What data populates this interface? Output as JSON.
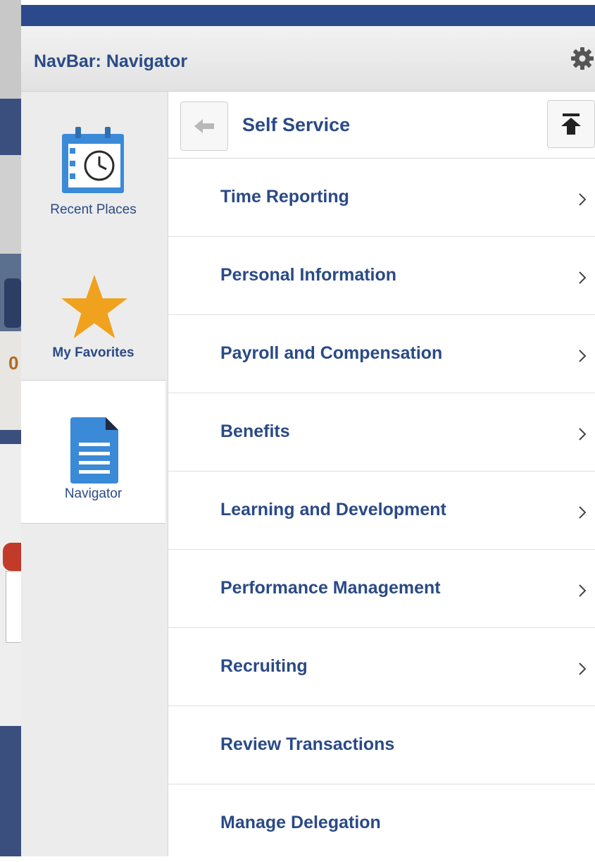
{
  "header": {
    "title": "NavBar: Navigator",
    "settings_icon": "gear-icon"
  },
  "tabs": [
    {
      "label": "Recent Places",
      "icon": "calendar-clock-icon"
    },
    {
      "label": "My Favorites",
      "icon": "star-icon"
    },
    {
      "label": "Navigator",
      "icon": "document-icon",
      "active": true
    }
  ],
  "nav": {
    "title": "Self Service",
    "back_icon": "back-arrow-icon",
    "top_icon": "scroll-top-icon",
    "items": [
      {
        "label": "Time Reporting",
        "has_children": true
      },
      {
        "label": "Personal Information",
        "has_children": true
      },
      {
        "label": "Payroll and Compensation",
        "has_children": true
      },
      {
        "label": "Benefits",
        "has_children": true
      },
      {
        "label": "Learning and Development",
        "has_children": true
      },
      {
        "label": "Performance Management",
        "has_children": true
      },
      {
        "label": "Recruiting",
        "has_children": true
      },
      {
        "label": "Review Transactions",
        "has_children": false
      },
      {
        "label": "Manage Delegation",
        "has_children": false
      }
    ]
  },
  "background_page": {
    "visible_number": "0"
  },
  "colors": {
    "brand": "#2a4a86",
    "accent": "#f0a11e",
    "doc_blue": "#3a8ad8"
  }
}
